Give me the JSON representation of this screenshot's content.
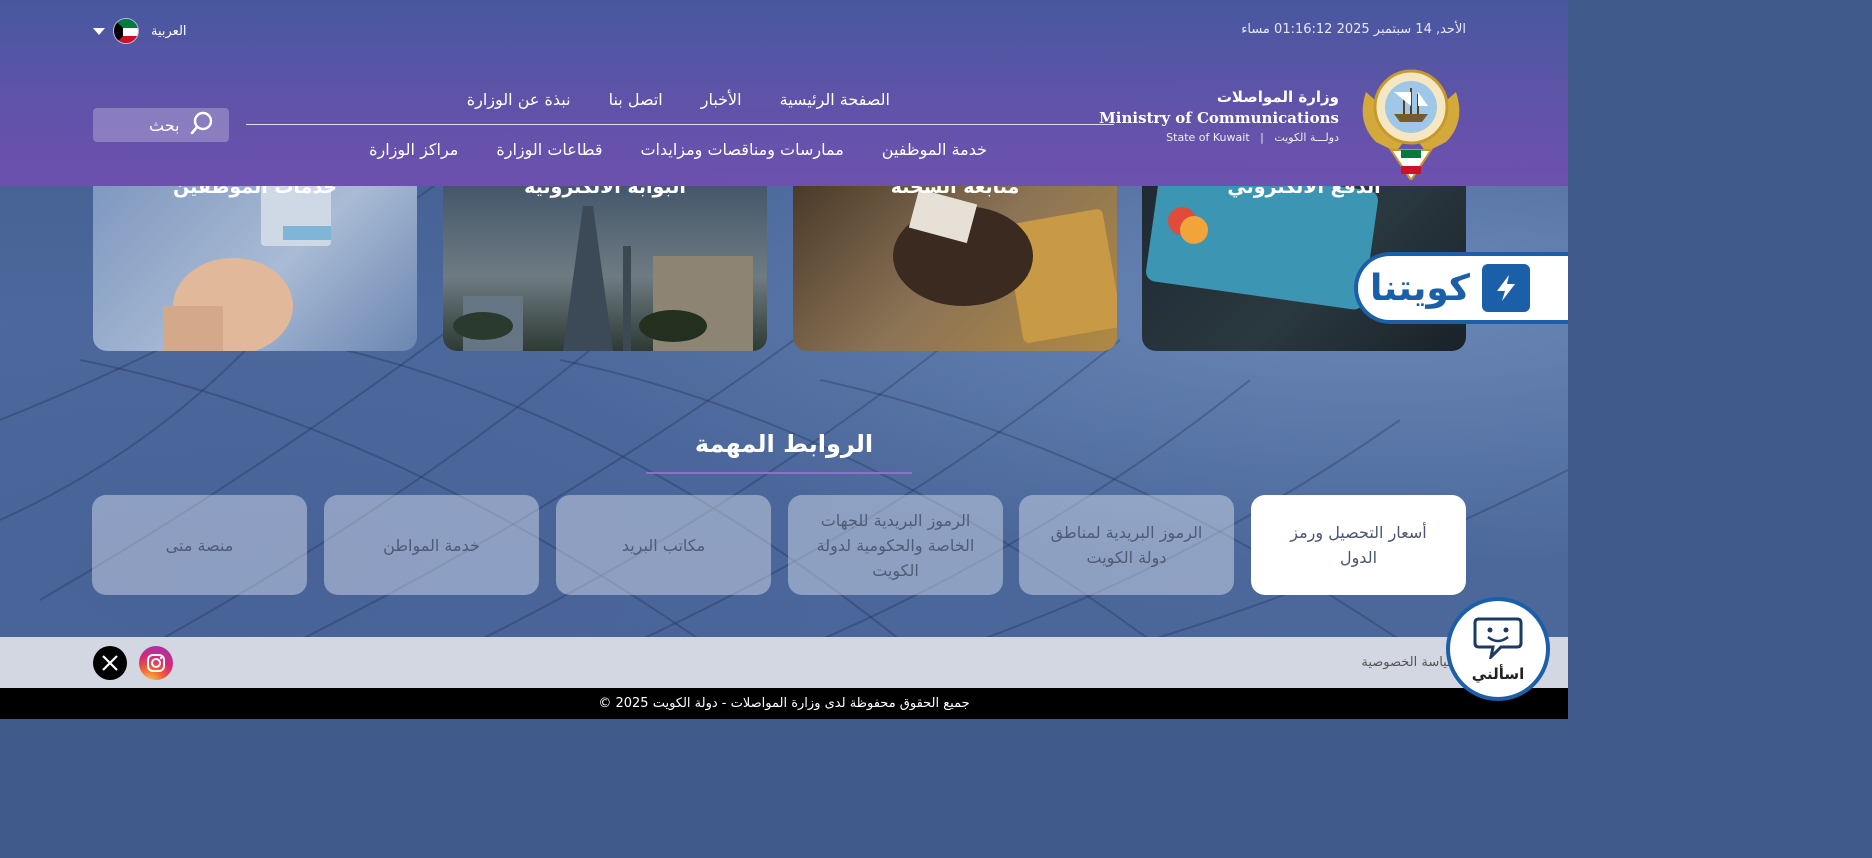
{
  "header": {
    "datetime": "الأحد, 14 سبتمبر 2025 01:16:12 مساء",
    "language": "العربية",
    "ministry_ar": "وزارة المواصلات",
    "ministry_en": "Ministry of Communications",
    "state_en": "State of Kuwait",
    "state_ar": "دولـــة الكويت",
    "nav_row1": [
      "الصفحة الرئيسية",
      "الأخبار",
      "اتصل بنا",
      "نبذة عن الوزارة"
    ],
    "nav_row2": [
      "خدمة الموظفين",
      "ممارسات ومناقصات ومزايدات",
      "قطاعات الوزارة",
      "مراكز الوزارة"
    ],
    "search_label": "بحث"
  },
  "service_cards": [
    {
      "title": "خدمات الموظفين"
    },
    {
      "title": "البوابة الالكترونية"
    },
    {
      "title": "متابعة الشحنة"
    },
    {
      "title": "الدفع الالكتروني"
    }
  ],
  "kuwaiti_badge": "كويتنا",
  "important_links": {
    "title": "الروابط المهمة",
    "items": [
      "أسعار التحصيل ورمز الدول",
      "الرموز البريدية لمناطق دولة الكويت",
      "الرموز البريدية للجهات الخاصة والحكومية لدولة الكويت",
      "مكاتب البريد",
      "خدمة المواطن",
      "منصة متى"
    ]
  },
  "footer": {
    "privacy": "سياسة الخصوصية",
    "copyright": "جميع الحقوق محفوظة لدى وزارة المواصلات - دولة الكويت 2025 ©"
  },
  "chat": {
    "label": "اسألني"
  },
  "colors": {
    "header": "#6452aa",
    "accent_line": "#8a72c8",
    "badge_blue": "#1b5fa8"
  }
}
